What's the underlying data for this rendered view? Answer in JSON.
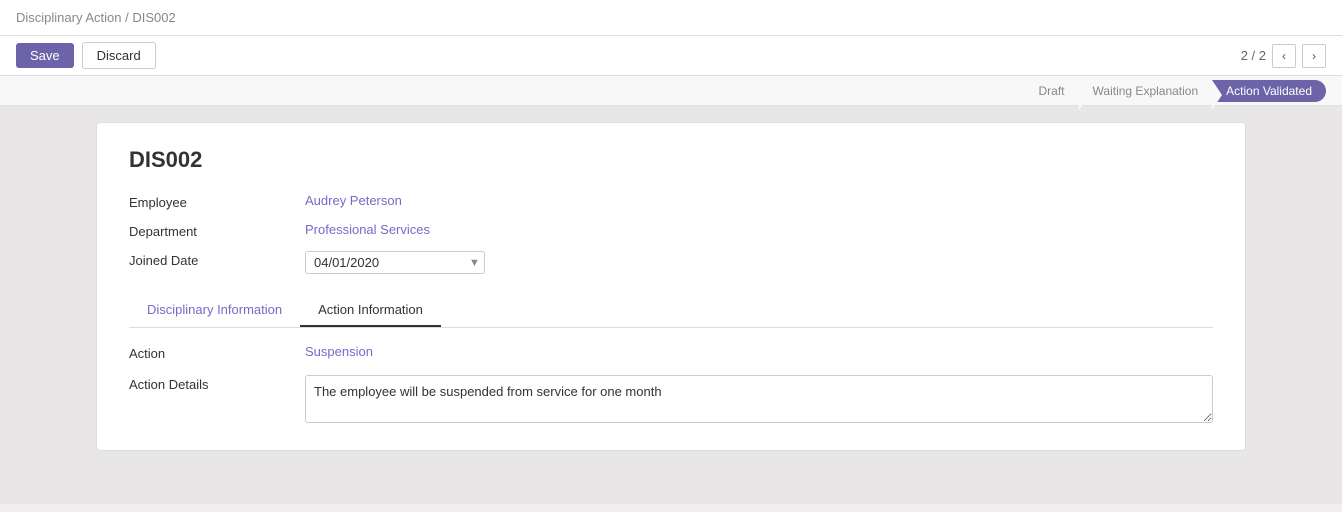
{
  "breadcrumb": {
    "parent": "Disciplinary Action",
    "separator": "/",
    "current": "DIS002"
  },
  "toolbar": {
    "save_label": "Save",
    "discard_label": "Discard",
    "pagination": "2 / 2"
  },
  "status": {
    "steps": [
      {
        "key": "draft",
        "label": "Draft",
        "active": false
      },
      {
        "key": "waiting",
        "label": "Waiting Explanation",
        "active": false
      },
      {
        "key": "validated",
        "label": "Action Validated",
        "active": true
      }
    ]
  },
  "form": {
    "record_id": "DIS002",
    "employee_label": "Employee",
    "employee_value": "Audrey Peterson",
    "department_label": "Department",
    "department_value": "Professional Services",
    "joined_date_label": "Joined Date",
    "joined_date_value": "04/01/2020"
  },
  "tabs": [
    {
      "key": "disciplinary",
      "label": "Disciplinary Information",
      "active": false
    },
    {
      "key": "action",
      "label": "Action Information",
      "active": true
    }
  ],
  "action_section": {
    "action_label": "Action",
    "action_value": "Suspension",
    "action_details_label": "Action Details",
    "action_details_value": "The employee will be suspended from service for one month"
  }
}
